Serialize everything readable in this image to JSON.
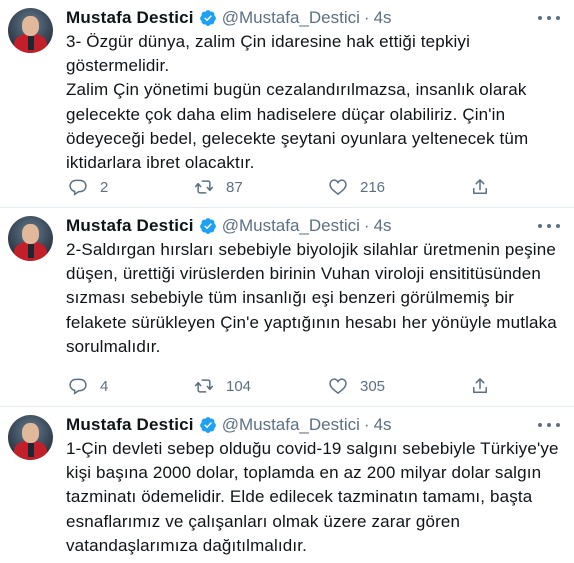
{
  "tweets": [
    {
      "author": "Mustafa Destici",
      "handle": "@Mustafa_Destici",
      "separator": "·",
      "time": "4s",
      "paragraphs": [
        "3- Özgür dünya, zalim Çin idaresine hak ettiği tepkiyi göstermelidir.",
        "Zalim  Çin yönetimi bugün cezalandırılmazsa, insanlık olarak gelecekte çok daha elim hadiselere düçar olabiliriz. Çin'in ödeyeceği bedel, gelecekte şeytani oyunlara yeltenecek tüm iktidarlara ibret olacaktır."
      ],
      "replies": "2",
      "retweets": "87",
      "likes": "216"
    },
    {
      "author": "Mustafa Destici",
      "handle": "@Mustafa_Destici",
      "separator": "·",
      "time": "4s",
      "paragraphs": [
        "2-Saldırgan hırsları sebebiyle biyolojik silahlar üretmenin peşine düşen, ürettiği virüslerden birinin Vuhan viroloji ensititüsünden sızması sebebiyle tüm insanlığı eşi benzeri görülmemiş bir felakete sürükleyen Çin'e yaptığının hesabı her yönüyle mutlaka sorulmalıdır."
      ],
      "replies": "4",
      "retweets": "104",
      "likes": "305"
    },
    {
      "author": "Mustafa Destici",
      "handle": "@Mustafa_Destici",
      "separator": "·",
      "time": "4s",
      "paragraphs": [
        "1-Çin devleti sebep olduğu covid-19 salgını sebebiyle Türkiye'ye kişi başına 2000 dolar, toplamda en az 200 milyar dolar salgın tazminatı ödemelidir. Elde edilecek tazminatın tamamı, başta esnaflarımız ve çalışanları olmak üzere zarar gören vatandaşlarımıza dağıtılmalıdır."
      ]
    }
  ],
  "colors": {
    "verified": "#1da1f2",
    "muted": "#5b7083",
    "text": "#0f1419"
  }
}
